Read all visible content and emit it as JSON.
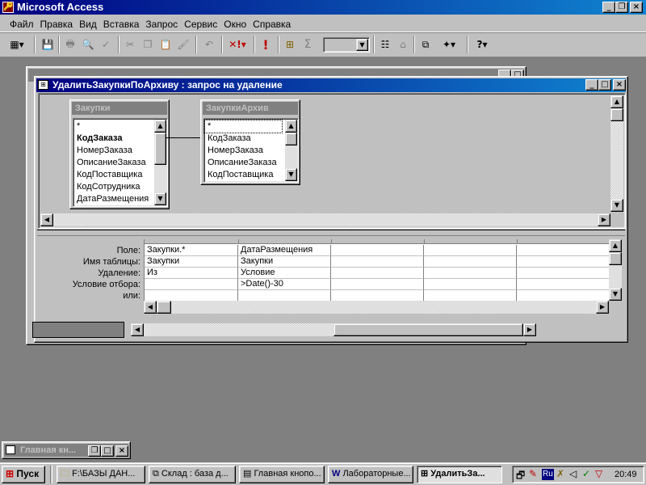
{
  "app": {
    "title": "Microsoft Access"
  },
  "menu": [
    "Файл",
    "Правка",
    "Вид",
    "Вставка",
    "Запрос",
    "Сервис",
    "Окно",
    "Справка"
  ],
  "toolbar": {
    "icons": [
      "view-icon",
      "save-icon",
      "print-icon",
      "print-preview-icon",
      "spelling-icon",
      "cut-icon",
      "copy-icon",
      "paste-icon",
      "format-painter-icon",
      "undo-icon",
      "query-type-icon",
      "run-icon",
      "show-table-icon",
      "totals-icon",
      "top-values-icon",
      "properties-icon",
      "build-icon",
      "database-window-icon",
      "new-object-icon",
      "help-icon"
    ],
    "run_label": "!",
    "totals_label": "Σ",
    "help_label": "?"
  },
  "bg_window": {
    "title": ""
  },
  "query_window": {
    "title": "УдалитьЗакупкиПоАрхиву : запрос на удаление"
  },
  "tables": [
    {
      "name": "Закупки",
      "fields": [
        "*",
        "КодЗаказа",
        "НомерЗаказа",
        "ОписаниеЗаказа",
        "КодПоставщика",
        "КодСотрудника",
        "ДатаРазмещения"
      ]
    },
    {
      "name": "ЗакупкиАрхив",
      "fields": [
        "*",
        "КодЗаказа",
        "НомерЗаказа",
        "ОписаниеЗаказа",
        "КодПоставщика"
      ]
    }
  ],
  "grid": {
    "row_labels": [
      "Поле:",
      "Имя таблицы:",
      "Удаление:",
      "Условие отбора:",
      "или:"
    ],
    "col1": {
      "field": "Закупки.*",
      "table": "Закупки",
      "delete": "Из",
      "criteria": ""
    },
    "col2": {
      "field": "ДатаРазмещения",
      "table": "Закупки",
      "delete": "Условие",
      "criteria": ">Date()-30"
    }
  },
  "minimized_window": {
    "title": "Главная кн..."
  },
  "taskbar": {
    "start": "Пуск",
    "items": [
      "F:\\БАЗЫ ДАН...",
      "Склад : база д...",
      "Главная кнопо...",
      "Лабораторные...",
      "УдалитьЗа..."
    ],
    "lang": "Ru",
    "time": "20:49"
  }
}
